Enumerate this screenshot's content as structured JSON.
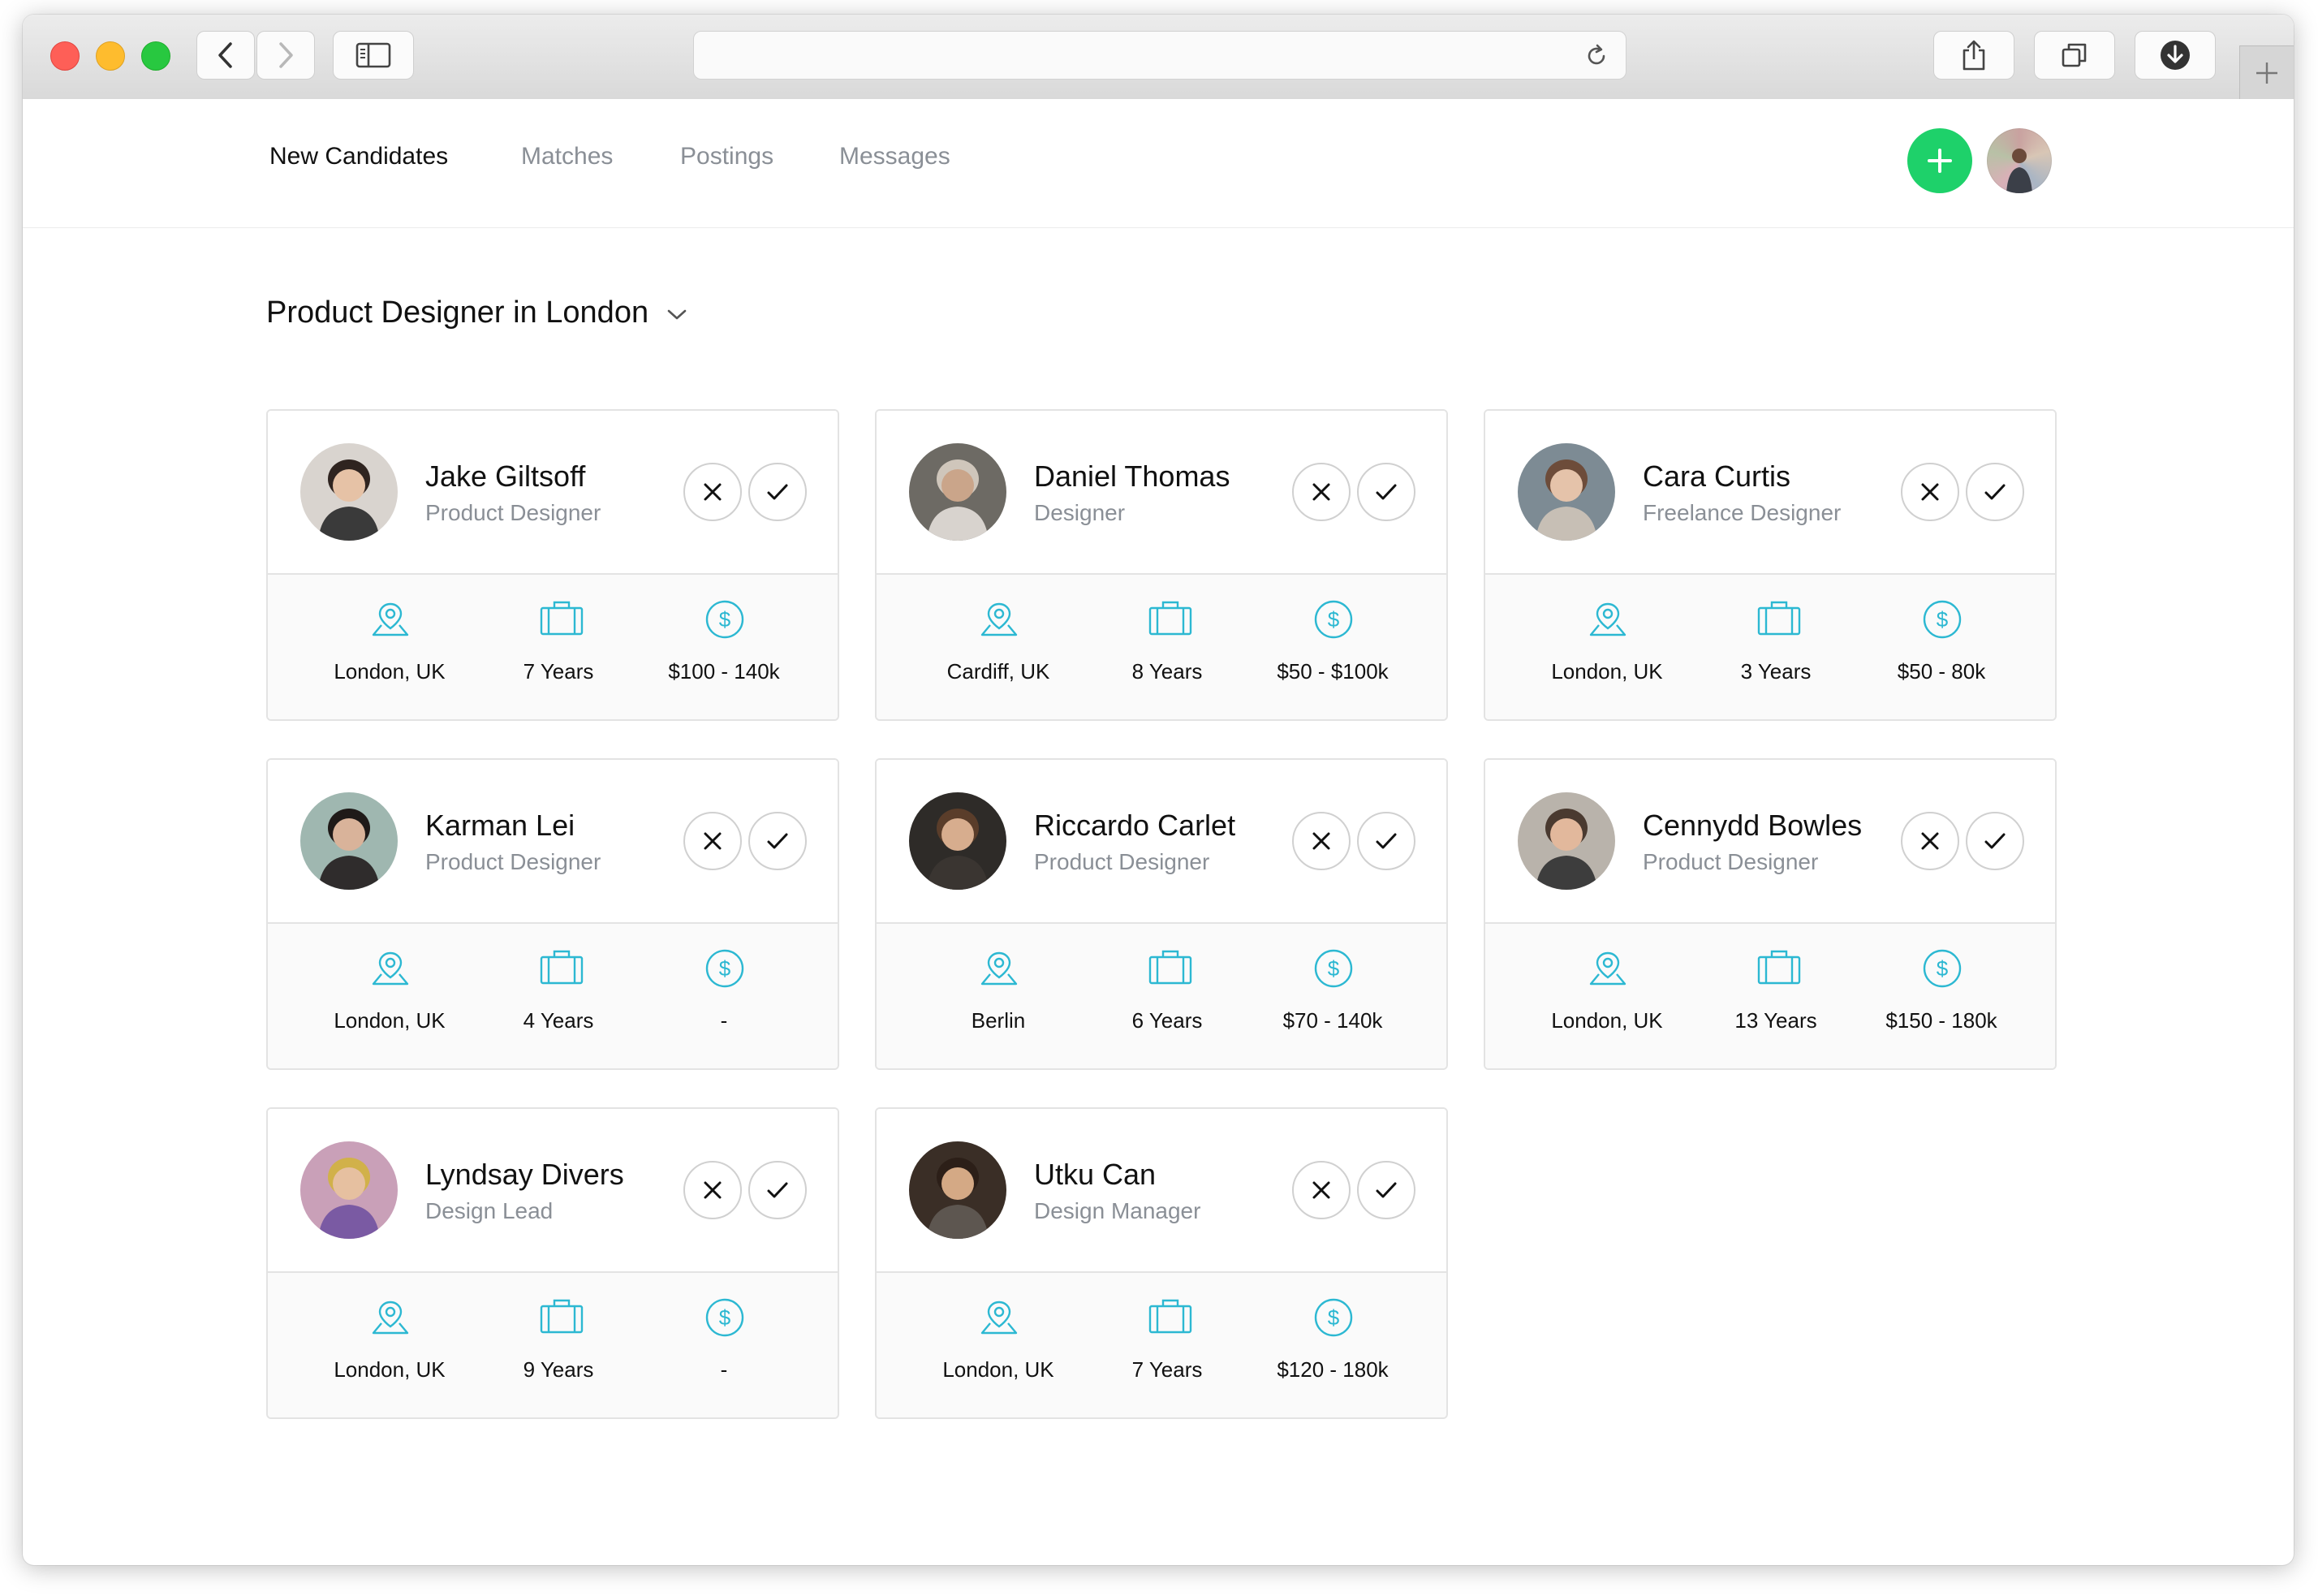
{
  "browser": {
    "colors": {
      "close": "#fe5f57",
      "minimize": "#febc2e",
      "zoom": "#28c840"
    },
    "address": ""
  },
  "nav": {
    "tabs": [
      "New Candidates",
      "Matches",
      "Postings",
      "Messages"
    ],
    "active_tab": "New Candidates",
    "accent_color": "#1ed16a"
  },
  "page": {
    "title": "Product Designer in London"
  },
  "icon_color": "#2cb8d2",
  "candidates": [
    {
      "name": "Jake Giltsoff",
      "role": "Product Designer",
      "location": "London, UK",
      "experience": "7 Years",
      "salary": "$100 - 140k"
    },
    {
      "name": "Daniel Thomas",
      "role": "Designer",
      "location": "Cardiff, UK",
      "experience": "8 Years",
      "salary": "$50 - $100k"
    },
    {
      "name": "Cara Curtis",
      "role": "Freelance Designer",
      "location": "London, UK",
      "experience": "3 Years",
      "salary": "$50 - 80k"
    },
    {
      "name": "Karman Lei",
      "role": "Product Designer",
      "location": "London, UK",
      "experience": "4 Years",
      "salary": "-"
    },
    {
      "name": "Riccardo Carlet",
      "role": "Product Designer",
      "location": "Berlin",
      "experience": "6 Years",
      "salary": "$70 - 140k"
    },
    {
      "name": "Cennydd Bowles",
      "role": "Product Designer",
      "location": "London, UK",
      "experience": "13 Years",
      "salary": "$150 - 180k"
    },
    {
      "name": "Lyndsay Divers",
      "role": "Design Lead",
      "location": "London, UK",
      "experience": "9 Years",
      "salary": "-"
    },
    {
      "name": "Utku Can",
      "role": "Design Manager",
      "location": "London, UK",
      "experience": "7 Years",
      "salary": "$120 - 180k"
    }
  ]
}
